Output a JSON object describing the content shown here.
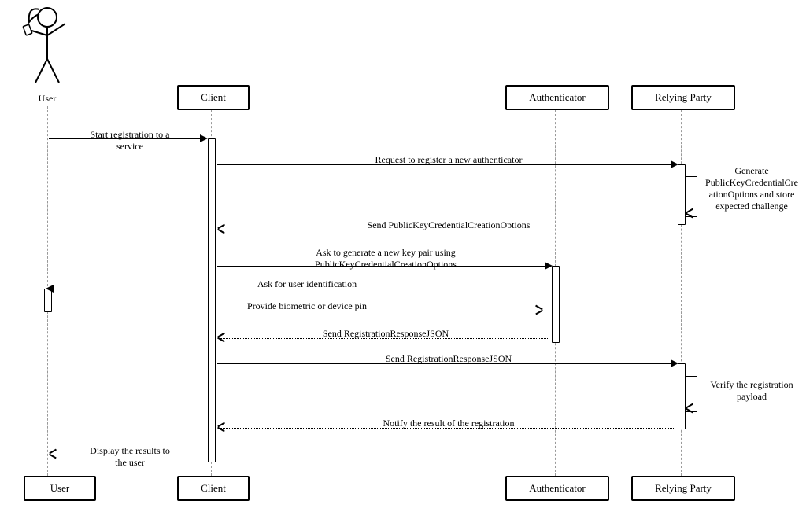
{
  "chart_data": {
    "type": "sequence_diagram",
    "participants": [
      "User",
      "Client",
      "Authenticator",
      "Relying Party"
    ],
    "messages": [
      {
        "from": "User",
        "to": "Client",
        "label": "Start registration to a service",
        "style": "solid"
      },
      {
        "from": "Client",
        "to": "Relying Party",
        "label": "Request to register a new authenticator",
        "style": "solid"
      },
      {
        "from": "Relying Party",
        "to": "Relying Party",
        "label": "Generate PublicKeyCredentialCreationOptions and store expected challenge",
        "style": "self-note"
      },
      {
        "from": "Relying Party",
        "to": "Client",
        "label": "Send PublicKeyCredentialCreationOptions",
        "style": "dashed"
      },
      {
        "from": "Client",
        "to": "Authenticator",
        "label": "Ask to generate a new key pair using PublicKeyCredentialCreationOptions",
        "style": "solid"
      },
      {
        "from": "Authenticator",
        "to": "User",
        "label": "Ask for user identification",
        "style": "solid"
      },
      {
        "from": "User",
        "to": "Authenticator",
        "label": "Provide biometric or device pin",
        "style": "dashed"
      },
      {
        "from": "Authenticator",
        "to": "Client",
        "label": "Send RegistrationResponseJSON",
        "style": "dashed"
      },
      {
        "from": "Client",
        "to": "Relying Party",
        "label": "Send RegistrationResponseJSON",
        "style": "solid"
      },
      {
        "from": "Relying Party",
        "to": "Relying Party",
        "label": "Verify the registration payload",
        "style": "self-note"
      },
      {
        "from": "Relying Party",
        "to": "Client",
        "label": "Notify the result of the registration",
        "style": "dashed"
      },
      {
        "from": "Client",
        "to": "User",
        "label": "Display the results to the user",
        "style": "dashed"
      }
    ]
  },
  "actors": {
    "user": "User",
    "client": "Client",
    "authenticator": "Authenticator",
    "relying_party": "Relying Party"
  },
  "messages": {
    "m1": "Start registration to a\nservice",
    "m2": "Request to register a new authenticator",
    "note1": "Generate\nPublicKeyCredentialCre\nationOptions and\nstore expected\nchallenge",
    "m3": "Send PublicKeyCredentialCreationOptions",
    "m4": "Ask to generate a new key pair using\nPublicKeyCredentialCreationOptions",
    "m5": "Ask for user identification",
    "m6": "Provide biometric or device pin",
    "m7": "Send RegistrationResponseJSON",
    "m8": "Send RegistrationResponseJSON",
    "note2": "Verify the registration\npayload",
    "m9": "Notify the result of the registration",
    "m10": "Display the results to\nthe user"
  }
}
